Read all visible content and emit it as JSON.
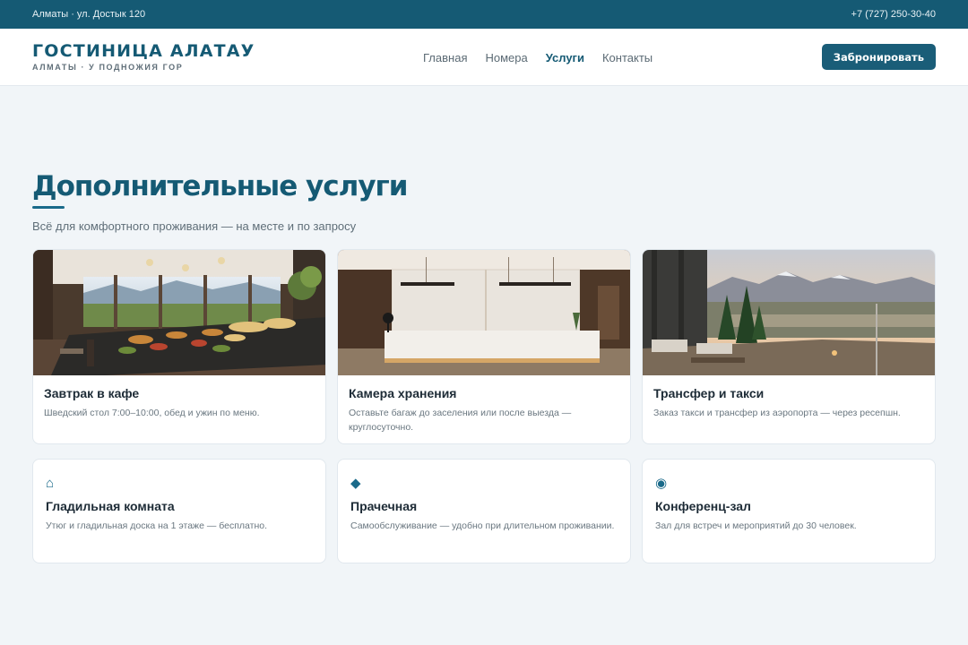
{
  "topbar": {
    "address": "Алматы · ул. Достык 120",
    "phone": "+7 (727) 250-30-40"
  },
  "brand": {
    "name": "ГОСТИНИЦА АЛАТАУ",
    "tagline": "АЛМАТЫ · У ПОДНОЖИЯ ГОР"
  },
  "nav": {
    "items": [
      "Главная",
      "Номера",
      "Услуги",
      "Контакты"
    ],
    "active": "Услуги"
  },
  "header": {
    "book_label": "Забронировать"
  },
  "page": {
    "title": "Дополнительные услуги",
    "subtitle": "Всё для комфортного проживания — на месте и по запросу"
  },
  "photo_services": [
    {
      "title": "Завтрак в кафе",
      "desc": "Шведский стол 7:00–10:00, обед и ужин по меню.",
      "photo": "breakfast-buffet-photo"
    },
    {
      "title": "Камера хранения",
      "desc": "Оставьте багаж до заселения или после выезда — круглосуточно.",
      "photo": "reception-desk-photo"
    },
    {
      "title": "Трансфер и такси",
      "desc": "Заказ такси и трансфер из аэропорта — через ресепшн.",
      "photo": "mountain-terrace-photo"
    }
  ],
  "icon_services": [
    {
      "icon": "⌂",
      "icon_name": "home-icon",
      "title": "Гладильная комната",
      "desc": "Утюг и гладильная доска на 1 этаже — бесплатно."
    },
    {
      "icon": "◆",
      "icon_name": "diamond-icon",
      "title": "Прачечная",
      "desc": "Самообслуживание — удобно при длительном проживании."
    },
    {
      "icon": "◉",
      "icon_name": "target-icon",
      "title": "Конференц-зал",
      "desc": "Зал для встреч и мероприятий до 30 человек."
    }
  ],
  "colors": {
    "primary": "#155a74",
    "background": "#f1f5f8",
    "text": "#1d2b36",
    "muted": "#5f6e78"
  }
}
